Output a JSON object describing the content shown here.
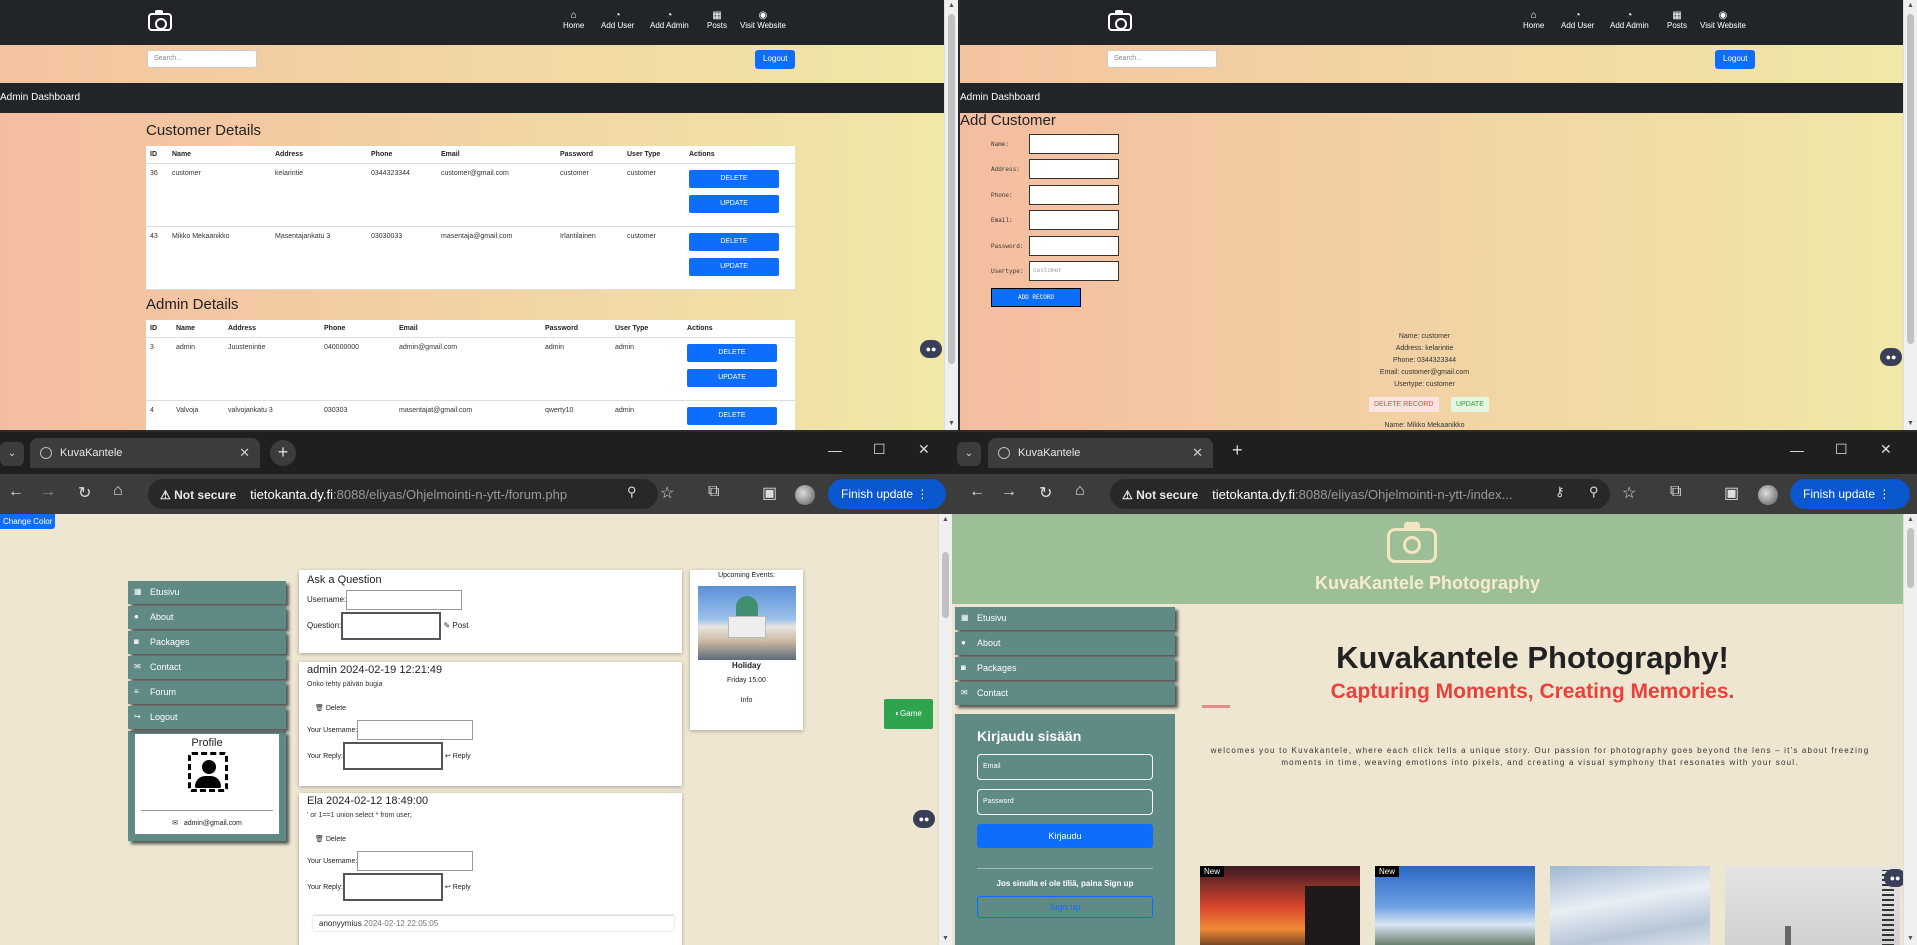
{
  "top_left": {
    "nav": {
      "items": [
        {
          "icon": "home-icon",
          "glyph": "⌂",
          "label": "Home"
        },
        {
          "icon": "speedometer-icon",
          "glyph": "◔",
          "label": "Add User"
        },
        {
          "icon": "speedometer-icon",
          "glyph": "◔",
          "label": "Add Admin"
        },
        {
          "icon": "posts-icon",
          "glyph": "▦",
          "label": "Posts"
        },
        {
          "icon": "user-circle-icon",
          "glyph": "◉",
          "label": "Visit Website"
        }
      ]
    },
    "search_placeholder": "Search...",
    "logout_label": "Logout",
    "dashboard_title": "Admin Dashboard",
    "customer_section_title": "Customer Details",
    "customer_headers": [
      "ID",
      "Name",
      "Address",
      "Phone",
      "Email",
      "Password",
      "User Type",
      "Actions"
    ],
    "customers": [
      {
        "id": "36",
        "name": "customer",
        "address": "kelarintie",
        "phone": "0344323344",
        "email": "customer@gmail.com",
        "password": "customer",
        "type": "customer"
      },
      {
        "id": "43",
        "name": "Mikko Mekaanikko",
        "address": "Masentajankatu 3",
        "phone": "03030033",
        "email": "masentaja@gmail.com",
        "password": "Irlantilainen",
        "type": "customer"
      }
    ],
    "admin_section_title": "Admin Details",
    "admin_headers": [
      "ID",
      "Name",
      "Address",
      "Phone",
      "Email",
      "Password",
      "User Type",
      "Actions"
    ],
    "admins": [
      {
        "id": "3",
        "name": "admin",
        "address": "Juustenintie",
        "phone": "040000000",
        "email": "admin@gmail.com",
        "password": "admin",
        "type": "admin"
      },
      {
        "id": "4",
        "name": "Valvoja",
        "address": "valvojankatu 3",
        "phone": "030303",
        "email": "masentajat@gmail.com",
        "password": "qwerty10",
        "type": "admin"
      }
    ],
    "delete_label": "DELETE",
    "update_label": "UPDATE"
  },
  "top_right": {
    "nav_items": [
      "Home",
      "Add User",
      "Add Admin",
      "Posts",
      "Visit Website"
    ],
    "search_placeholder": "Search...",
    "logout_label": "Logout",
    "dashboard_title": "Admin Dashboard",
    "form_title": "Add Customer",
    "fields": [
      "Name:",
      "Address:",
      "Phone:",
      "Email:",
      "Password:",
      "Usertype:"
    ],
    "usertype_placeholder": "customer",
    "add_record_label": "ADD RECORD",
    "record": {
      "name": "Name: customer",
      "address": "Address: kelarintie",
      "phone": "Phone: 0344323344",
      "email": "Email: customer@gmail.com",
      "usertype": "Usertype: customer"
    },
    "delete_record_label": "DELETE RECORD",
    "update_label": "UPDATE",
    "next_record_name": "Name: Mikko Mekaanikko"
  },
  "bottom_left": {
    "tab_title": "KuvaKantele",
    "omnibox": {
      "not_secure": "Not secure",
      "host": "tietokanta.dy.fi",
      "path": ":8088/eliyas/Ohjelmointi-n-ytt-/forum.php"
    },
    "finish_update": "Finish update",
    "change_color": "Change Color",
    "menu": [
      {
        "icon": "grid-icon",
        "glyph": "▦",
        "label": "Etusivu"
      },
      {
        "icon": "user-icon",
        "glyph": "●",
        "label": "About"
      },
      {
        "icon": "camera-icon",
        "glyph": "◙",
        "label": "Packages"
      },
      {
        "icon": "envelope-icon",
        "glyph": "✉",
        "label": "Contact"
      },
      {
        "icon": "list-icon",
        "glyph": "≡",
        "label": "Forum"
      },
      {
        "icon": "logout-icon",
        "glyph": "↪",
        "label": "Logout"
      }
    ],
    "profile_title": "Profile",
    "profile_email": "admin@gmail.com",
    "ask_title": "Ask a Question",
    "username_label": "Username:",
    "question_label": "Question:",
    "post_label": "Post",
    "posts": [
      {
        "header": "admin 2024-02-19 12:21:49",
        "body": "Onko tehty päivän bugia",
        "delete": "Delete",
        "your_username": "Your Username:",
        "your_reply": "Your Reply:",
        "reply": "Reply"
      },
      {
        "header": "Ela 2024-02-12 18:49:00",
        "body": "' or 1==1 union select * from user;",
        "delete": "Delete",
        "your_username": "Your Username:",
        "your_reply": "Your Reply:",
        "reply": "Reply"
      }
    ],
    "reply_author": "anonyymius",
    "reply_time": "2024-02-12 22:05:05",
    "events_title": "Upcoming Events:",
    "event_name": "Holiday",
    "event_time": "Friday 15:00",
    "event_info": "Info",
    "game_label": "Game"
  },
  "bottom_right": {
    "tab_title": "KuvaKantele",
    "omnibox": {
      "not_secure": "Not secure",
      "host": "tietokanta.dy.fi",
      "path": ":8088/eliyas/Ohjelmointi-n-ytt-/index..."
    },
    "finish_update": "Finish update",
    "brand": "KuvaKantele Photography",
    "menu": [
      {
        "icon": "grid-icon",
        "glyph": "▦",
        "label": "Etusivu"
      },
      {
        "icon": "user-icon",
        "glyph": "●",
        "label": "About"
      },
      {
        "icon": "camera-icon",
        "glyph": "◙",
        "label": "Packages"
      },
      {
        "icon": "envelope-icon",
        "glyph": "✉",
        "label": "Contact"
      }
    ],
    "login_title": "Kirjaudu sisään",
    "email_placeholder": "Email",
    "password_placeholder": "Password",
    "login_button": "Kirjaudu",
    "signup_prompt": "Jos sinulla ei ole tiliä, paina Sign up",
    "signup_button": "Sign up",
    "hero_title": "Kuvakantele Photography!",
    "hero_subtitle": "Capturing Moments, Creating Memories.",
    "intro": "welcomes you to Kuvakantele, where each click tells a unique story. Our passion for photography goes beyond the lens – it's about freezing moments in time, weaving emotions into pixels, and creating a visual symphony that resonates with your soul.",
    "badge_new": "New"
  },
  "colors": {
    "accent": "#0d6efd",
    "dark": "#212529",
    "menu": "#5f8a86",
    "hero_red": "#e8423a",
    "green_head": "#9cbf98"
  }
}
